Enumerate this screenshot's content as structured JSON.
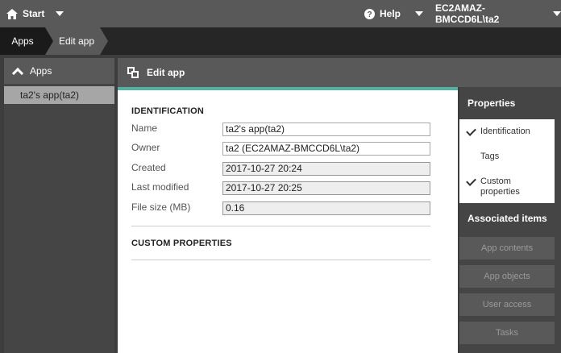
{
  "topbar": {
    "start_label": "Start",
    "help_label": "Help",
    "user_label": "EC2AMAZ-BMCCD6L\\ta2"
  },
  "breadcrumb": {
    "items": [
      "Apps",
      "Edit app"
    ]
  },
  "sidebar": {
    "header": "Apps",
    "items": [
      "ta2's app(ta2)"
    ]
  },
  "main": {
    "header": "Edit app",
    "identification_title": "IDENTIFICATION",
    "fields": [
      {
        "label": "Name",
        "value": "ta2's app(ta2)"
      },
      {
        "label": "Owner",
        "value": "ta2 (EC2AMAZ-BMCCD6L\\ta2)"
      },
      {
        "label": "Created",
        "value": "2017-10-27 20:24"
      },
      {
        "label": "Last modified",
        "value": "2017-10-27 20:25"
      },
      {
        "label": "File size (MB)",
        "value": "0.16"
      }
    ],
    "custom_properties_title": "CUSTOM PROPERTIES"
  },
  "properties_panel": {
    "title": "Properties",
    "items": [
      {
        "label": "Identification",
        "checked": true
      },
      {
        "label": "Tags",
        "checked": false
      },
      {
        "label": "Custom properties",
        "checked": true
      }
    ],
    "associated_title": "Associated items",
    "associated_items": [
      "App contents",
      "App objects",
      "User access",
      "Tasks"
    ]
  },
  "colors": {
    "accent": "#52b3a1",
    "topbar": "#595959",
    "crumbbar": "#262626"
  }
}
